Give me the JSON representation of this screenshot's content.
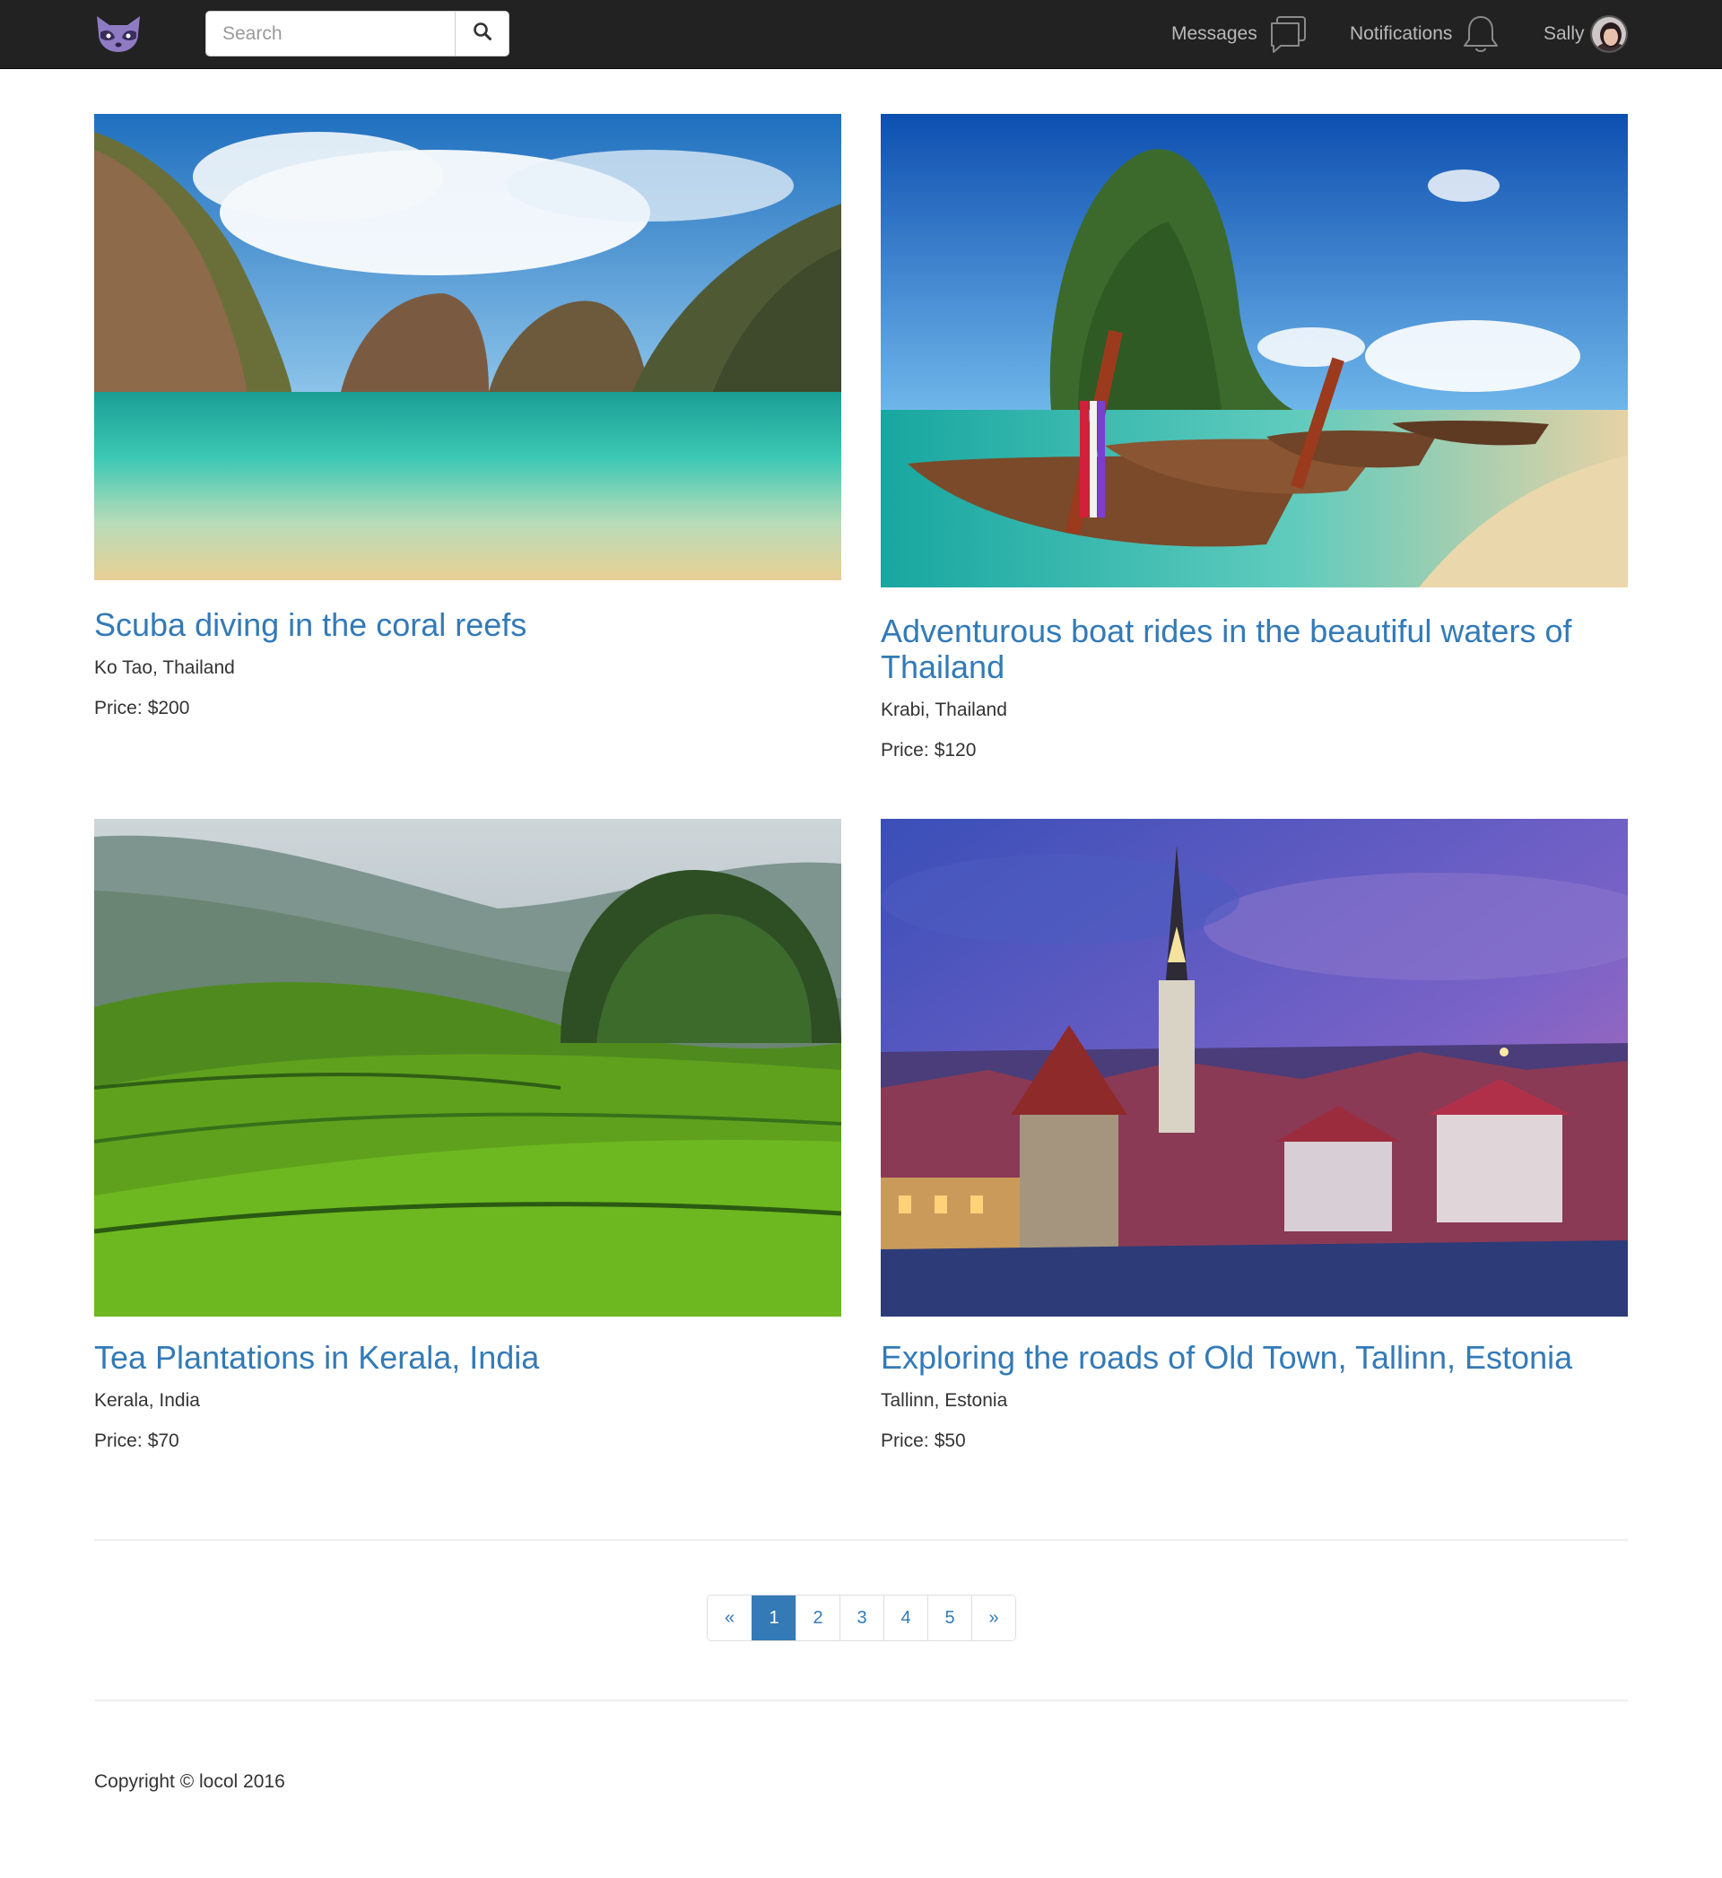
{
  "navbar": {
    "search": {
      "placeholder": "Search"
    },
    "messages_label": "Messages",
    "notifications_label": "Notifications",
    "user_name": "Sally"
  },
  "listings": [
    {
      "title": "Scuba diving in the coral reefs",
      "location": "Ko Tao, Thailand",
      "price_label": "Price:",
      "price": "$200"
    },
    {
      "title": "Adventurous boat rides in the beautiful waters of Thailand",
      "location": "Krabi, Thailand",
      "price_label": "Price:",
      "price": "$120"
    },
    {
      "title": "Tea Plantations in Kerala, India",
      "location": "Kerala, India",
      "price_label": "Price:",
      "price": "$70"
    },
    {
      "title": "Exploring the roads of Old Town, Tallinn, Estonia",
      "location": "Tallinn, Estonia",
      "price_label": "Price:",
      "price": "$50"
    }
  ],
  "pagination": {
    "prev": "«",
    "pages": [
      "1",
      "2",
      "3",
      "4",
      "5"
    ],
    "next": "»",
    "active_page": "1"
  },
  "footer": {
    "copyright": "Copyright © locol 2016"
  },
  "colors": {
    "navbar_bg": "#222222",
    "link": "#337ab7",
    "logo": "#8e7bc4"
  },
  "icons": [
    "raccoon-logo-icon",
    "search-icon",
    "chat-bubbles-icon",
    "bell-icon",
    "avatar"
  ]
}
